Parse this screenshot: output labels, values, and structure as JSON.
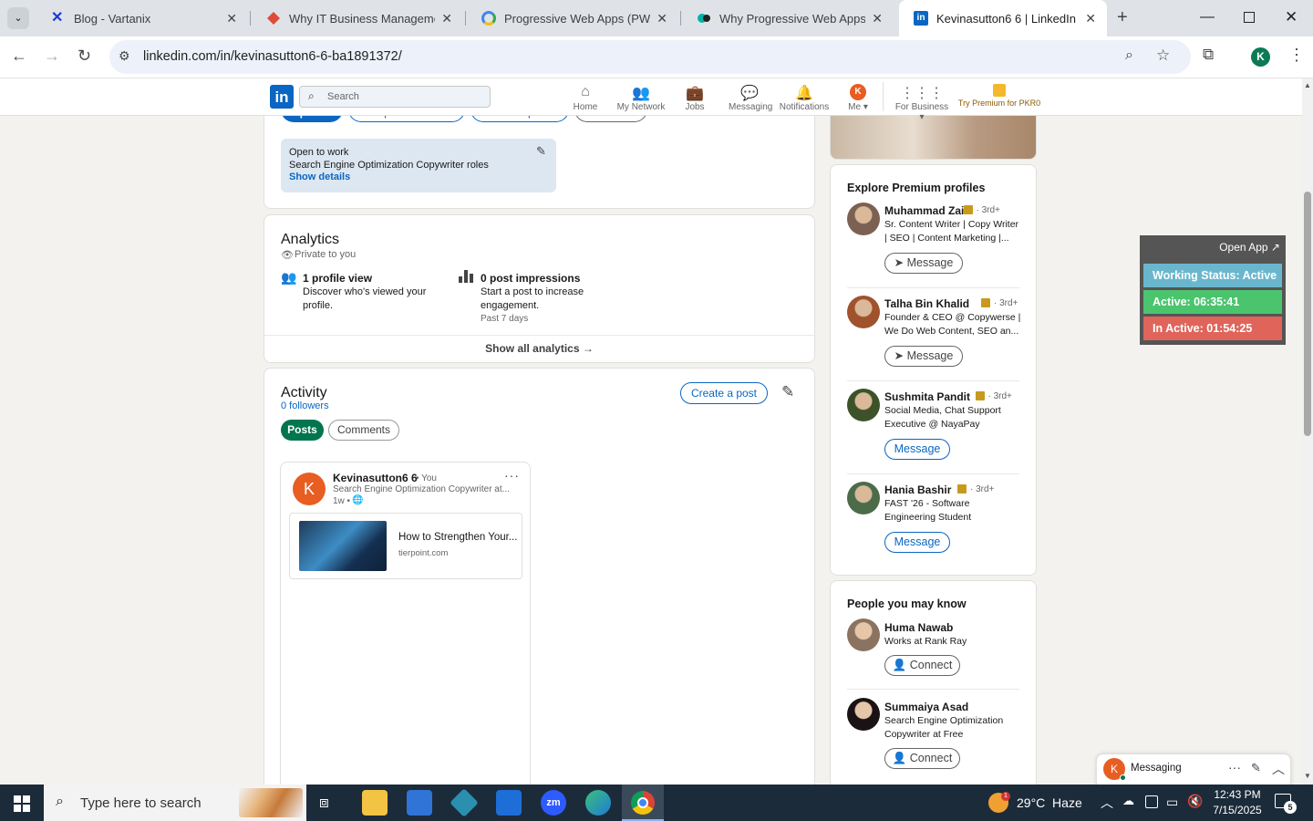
{
  "browser": {
    "tabs": [
      {
        "title": "Blog - Vartanix",
        "active": false
      },
      {
        "title": "Why IT Business Management i",
        "active": false
      },
      {
        "title": "Progressive Web Apps (PWA) W",
        "active": false
      },
      {
        "title": "Why Progressive Web Apps Ar",
        "active": false
      },
      {
        "title": "Kevinasutton6 6 | LinkedIn",
        "active": true
      }
    ],
    "url": "linkedin.com/in/kevinasutton6-6-ba1891372/",
    "profile_initial": "K"
  },
  "header": {
    "search_placeholder": "Search",
    "nav": {
      "home": "Home",
      "network": "My Network",
      "jobs": "Jobs",
      "messaging": "Messaging",
      "notifications": "Notifications",
      "me": "Me",
      "business": "For Business",
      "premium": "Try Premium for PKR0"
    },
    "me_initial": "K"
  },
  "profile": {
    "top_buttons": [
      "Open to",
      "Add profile section",
      "Enhance profile",
      "Resources"
    ],
    "open_to_work": {
      "title": "Open to work",
      "roles": "Search Engine Optimization Copywriter roles",
      "link": "Show details"
    }
  },
  "analytics": {
    "title": "Analytics",
    "privacy": "Private to you",
    "items": [
      {
        "title": "1 profile view",
        "desc_line1": "Discover who's viewed your",
        "desc_line2": "profile.",
        "extra": ""
      },
      {
        "title": "0 post impressions",
        "desc_line1": "Start a post to increase",
        "desc_line2": "engagement.",
        "extra": "Past 7 days"
      }
    ],
    "show_all": "Show all analytics →"
  },
  "activity": {
    "title": "Activity",
    "followers": "0 followers",
    "create_post": "Create a post",
    "tabs": [
      "Posts",
      "Comments"
    ],
    "post": {
      "author": "Kevinasutton6 6",
      "you": "• You",
      "headline": "Search Engine Optimization Copywriter at...",
      "time": "1w •",
      "link_title": "How to Strengthen Your...",
      "link_domain": "tierpoint.com",
      "avatar_initial": "K"
    }
  },
  "premium_profiles": {
    "title": "Explore Premium profiles",
    "people": [
      {
        "name": "Muhammad Zain",
        "degree": "· 3rd+",
        "line1": "Sr. Content Writer | Copy Writer",
        "line2": "| SEO | Content Marketing |...",
        "button": "Message",
        "color": "#7a6152"
      },
      {
        "name": "Talha Bin Khalid",
        "degree": "· 3rd+",
        "line1": "Founder & CEO @ Copywerse |",
        "line2": "We Do Web Content, SEO an...",
        "button": "Message",
        "color": "#a0522d"
      },
      {
        "name": "Sushmita Pandit",
        "degree": "· 3rd+",
        "line1": "Social Media, Chat Support",
        "line2": "Executive @ NayaPay",
        "button": "Message",
        "color": "#3d5229"
      },
      {
        "name": "Hania Bashir",
        "degree": "· 3rd+",
        "line1": "FAST '26 - Software",
        "line2": "Engineering Student",
        "button": "Message",
        "color": "#4c6b4a"
      }
    ]
  },
  "people_you_may_know": {
    "title": "People you may know",
    "people": [
      {
        "name": "Huma Nawab",
        "line1": "Works at Rank Ray",
        "line2": "",
        "button": "Connect",
        "color": "#8a7360"
      },
      {
        "name": "Summaiya Asad",
        "line1": "Search Engine Optimization",
        "line2": "Copywriter at Free",
        "button": "Connect",
        "color": "#1a1215"
      }
    ]
  },
  "status_widget": {
    "open_app": "Open App ↗",
    "working": "Working Status: Active",
    "active": "Active: 06:35:41",
    "inactive": "In Active: 01:54:25"
  },
  "messaging_bar": {
    "label": "Messaging",
    "initial": "K"
  },
  "taskbar": {
    "search_placeholder": "Type here to search",
    "weather": "29°C  Haze",
    "time": "12:43 PM",
    "date": "7/15/2025",
    "notifications": "5",
    "weather_badge": "1"
  },
  "colors": {
    "linkedin_blue": "#0a66c2",
    "green": "#01754f",
    "accent_orange": "#e85d22"
  }
}
